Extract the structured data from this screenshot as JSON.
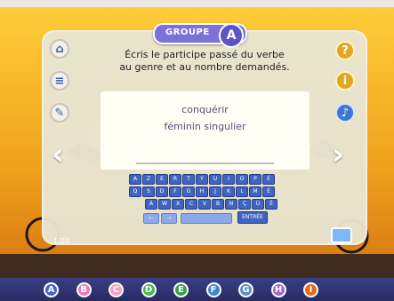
{
  "header": {
    "group_label": "GROUPE",
    "group_letter": "A"
  },
  "instruction": {
    "line1": "Écris le participe passé du verbe",
    "line2": "au genre et au nombre demandés."
  },
  "answer_box": {
    "verb": "conquérir",
    "form": "féminin singulier"
  },
  "left_buttons": [
    {
      "name": "home-icon",
      "glyph": "⌂"
    },
    {
      "name": "print-icon",
      "glyph": "≡"
    },
    {
      "name": "edit-icon",
      "glyph": "✎"
    }
  ],
  "right_buttons": [
    {
      "name": "help-icon",
      "glyph": "?"
    },
    {
      "name": "info-icon",
      "glyph": "i"
    },
    {
      "name": "sound-icon",
      "glyph": "♪"
    }
  ],
  "keyboard": {
    "row1": [
      "A",
      "Z",
      "E",
      "R",
      "T",
      "Y",
      "U",
      "I",
      "O",
      "P",
      "É"
    ],
    "row2": [
      "Q",
      "S",
      "D",
      "F",
      "G",
      "H",
      "J",
      "K",
      "L",
      "M",
      "È"
    ],
    "row3": [
      "À",
      "W",
      "X",
      "C",
      "V",
      "B",
      "N",
      "Ç",
      "Ù",
      "Ê"
    ],
    "row4_left": [
      "←",
      "→"
    ],
    "enter_label": "ENTRÉE"
  },
  "counter": "1/20",
  "bottom_groups": [
    "A",
    "B",
    "C",
    "D",
    "E",
    "F",
    "G",
    "H",
    "I"
  ],
  "colors": {
    "group_pill": "#7b72d8",
    "keyboard_key": "#3f64c2",
    "bottom_bar": "#2a2f63"
  }
}
